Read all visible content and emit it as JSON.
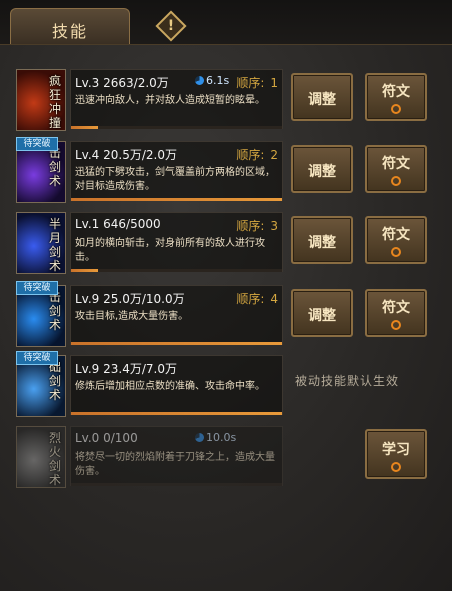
{
  "header": {
    "tab_label": "技能",
    "help_label": "!"
  },
  "skills": [
    {
      "icon_name": "charge-skill-icon",
      "icon_text": "疯狂冲撞",
      "badge": "",
      "level": "Lv.3 2663/2.0万",
      "cooldown": "6.1s",
      "order_label": "顺序:",
      "order": "1",
      "desc": "迅速冲向敌人，并对敌人造成短暂的眩晕。",
      "progress": 0.13,
      "adjust_label": "调整",
      "rune_label": "符文",
      "colors": [
        "#c23a16",
        "#3a0c06"
      ]
    },
    {
      "icon_name": "descending-strike-skill-icon",
      "icon_text": "击剑术",
      "badge": "待突破",
      "level": "Lv.4 20.5万/2.0万",
      "cooldown": "",
      "order_label": "顺序:",
      "order": "2",
      "desc": "迅猛的下劈攻击，剑气覆盖前方两格的区域，对目标造成伤害。",
      "progress": 1.0,
      "adjust_label": "调整",
      "rune_label": "符文",
      "colors": [
        "#7a3ce0",
        "#140a2e"
      ]
    },
    {
      "icon_name": "half-moon-sword-skill-icon",
      "icon_text": "半月剑术",
      "badge": "",
      "level": "Lv.1 646/5000",
      "cooldown": "",
      "order_label": "顺序:",
      "order": "3",
      "desc": "如月的横向斩击，对身前所有的敌人进行攻击。",
      "progress": 0.13,
      "adjust_label": "调整",
      "rune_label": "符文",
      "colors": [
        "#3a5cf0",
        "#0a1030"
      ]
    },
    {
      "icon_name": "strike-sword-skill-icon",
      "icon_text": "击剑术",
      "badge": "待突破",
      "level": "Lv.9 25.0万/10.0万",
      "cooldown": "",
      "order_label": "顺序:",
      "order": "4",
      "desc": "攻击目标,造成大量伤害。",
      "progress": 1.0,
      "adjust_label": "调整",
      "rune_label": "符文",
      "colors": [
        "#2a8cf0",
        "#06142e"
      ]
    },
    {
      "icon_name": "basic-sword-skill-icon",
      "icon_text": "础剑术",
      "badge": "待突破",
      "level": "Lv.9 23.4万/7.0万",
      "cooldown": "",
      "order_label": "",
      "order": "",
      "desc": "修炼后增加相应点数的准确、攻击命中率。",
      "progress": 1.0,
      "adjust_label": "",
      "rune_label": "",
      "colors": [
        "#4aa0f0",
        "#081830"
      ]
    },
    {
      "icon_name": "blazing-blade-skill-icon",
      "icon_text": "烈火剑术",
      "badge": "",
      "level": "Lv.0 0/100",
      "cooldown": "10.0s",
      "order_label": "",
      "order": "",
      "desc": "将焚尽一切的烈焰附着于刀锋之上，造成大量伤害。",
      "progress": 0.0,
      "adjust_label": "",
      "rune_label": "",
      "colors": [
        "#9a9a9a",
        "#2a2a2a"
      ]
    }
  ],
  "passive_note": "被动技能默认生效",
  "learn_label": "学习"
}
